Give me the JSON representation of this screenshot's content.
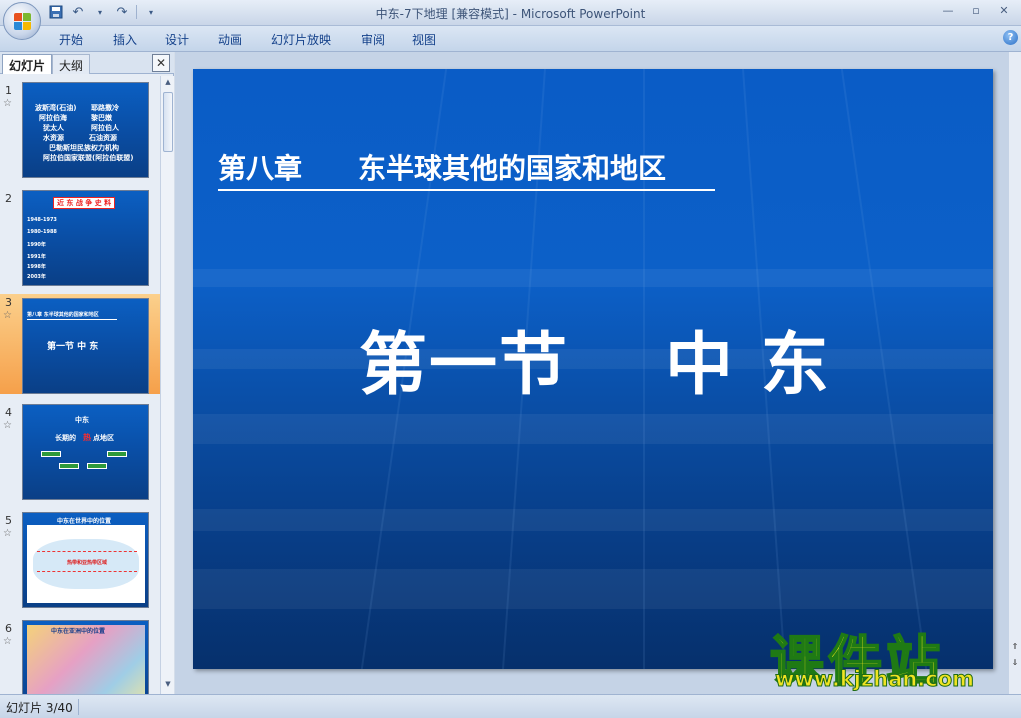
{
  "window": {
    "title": "中东-7下地理 [兼容模式]",
    "separator": "-",
    "app": "Microsoft PowerPoint"
  },
  "ribbon": {
    "tabs": [
      "开始",
      "插入",
      "设计",
      "动画",
      "幻灯片放映",
      "审阅",
      "视图"
    ]
  },
  "panel": {
    "tab_slides": "幻灯片",
    "tab_outline": "大纲",
    "close_label": "✕",
    "thumbnails": [
      {
        "number": "1",
        "lines": [
          "波斯湾(石油)",
          "耶路撒冷",
          "阿拉伯海",
          "黎巴嫩",
          "犹太人",
          "阿拉伯人",
          "水资源",
          "石油资源",
          "巴勒斯坦民族权力机构",
          "阿拉伯国家联盟(阿拉伯联盟)"
        ]
      },
      {
        "number": "2",
        "lines": [
          "近 东 战 争 史 料",
          "1948-1973",
          "1980-1988",
          "1990年",
          "1991年",
          "1998年",
          "2003年"
        ]
      },
      {
        "number": "3",
        "lines": [
          "第八章    东半球其他的国家和地区",
          "第一节    中 东"
        ]
      },
      {
        "number": "4",
        "lines": [
          "中东",
          "长期的",
          "热",
          "点地区"
        ]
      },
      {
        "number": "5",
        "lines": [
          "中东在世界中的位置",
          "热带和亚热带区域"
        ]
      },
      {
        "number": "6",
        "lines": [
          "中东在亚洲中的位置"
        ]
      }
    ]
  },
  "slide": {
    "chapter": "第八章",
    "chapter_title": "东半球其他的国家和地区",
    "section": "第一节",
    "section_title": "中 东"
  },
  "watermark": {
    "brand": "课件站",
    "url": "www.kjzhan.com"
  },
  "status": {
    "slide_indicator": "幻灯片 3/40"
  },
  "colors": {
    "slide_blue": "#0a5cc6",
    "selected_thumb": "#f6a04a",
    "watermark_yellow": "#f5e81c"
  }
}
